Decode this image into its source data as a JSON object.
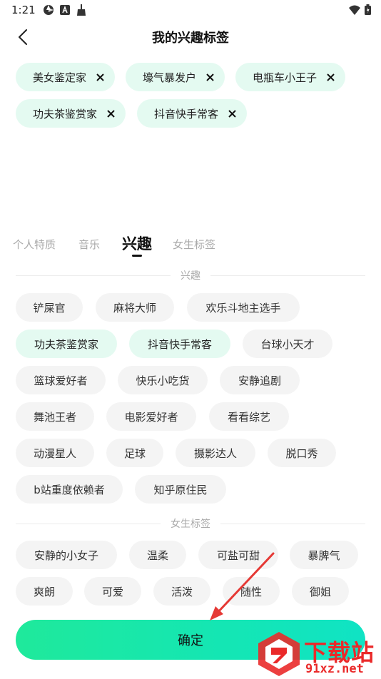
{
  "status_bar": {
    "time": "1:21"
  },
  "header": {
    "title": "我的兴趣标签"
  },
  "selected_tags": [
    {
      "label": "美女鉴定家"
    },
    {
      "label": "壕气暴发户"
    },
    {
      "label": "电瓶车小王子"
    },
    {
      "label": "功夫茶鉴赏家"
    },
    {
      "label": "抖音快手常客"
    }
  ],
  "tabs": [
    {
      "label": "个人特质",
      "active": false
    },
    {
      "label": "音乐",
      "active": false
    },
    {
      "label": "兴趣",
      "active": true
    },
    {
      "label": "女生标签",
      "active": false
    }
  ],
  "sections": {
    "interest": {
      "title": "兴趣",
      "tags": [
        {
          "label": "铲屎官",
          "selected": false
        },
        {
          "label": "麻将大师",
          "selected": false
        },
        {
          "label": "欢乐斗地主选手",
          "selected": false
        },
        {
          "label": "功夫茶鉴赏家",
          "selected": true
        },
        {
          "label": "抖音快手常客",
          "selected": true
        },
        {
          "label": "台球小天才",
          "selected": false
        },
        {
          "label": "篮球爱好者",
          "selected": false
        },
        {
          "label": "快乐小吃货",
          "selected": false
        },
        {
          "label": "安静追剧",
          "selected": false
        },
        {
          "label": "舞池王者",
          "selected": false
        },
        {
          "label": "电影爱好者",
          "selected": false
        },
        {
          "label": "看看综艺",
          "selected": false
        },
        {
          "label": "动漫星人",
          "selected": false
        },
        {
          "label": "足球",
          "selected": false
        },
        {
          "label": "摄影达人",
          "selected": false
        },
        {
          "label": "脱口秀",
          "selected": false
        },
        {
          "label": "b站重度依赖者",
          "selected": false
        },
        {
          "label": "知乎原住民",
          "selected": false
        }
      ]
    },
    "girl": {
      "title": "女生标签",
      "tags": [
        {
          "label": "安静的小女子",
          "selected": false
        },
        {
          "label": "温柔",
          "selected": false
        },
        {
          "label": "可盐可甜",
          "selected": false
        },
        {
          "label": "暴脾气",
          "selected": false
        },
        {
          "label": "爽朗",
          "selected": false
        },
        {
          "label": "可爱",
          "selected": false
        },
        {
          "label": "活泼",
          "selected": false
        },
        {
          "label": "随性",
          "selected": false
        },
        {
          "label": "御姐",
          "selected": false
        }
      ]
    }
  },
  "confirm_button": {
    "label": "确定"
  },
  "watermark": {
    "main": "下载站",
    "sub": "91xz.net"
  },
  "colors": {
    "accent": "#1fe99b",
    "chip_selected_bg": "#e4faf1",
    "chip_bg": "#f4f4f4",
    "annotation_arrow": "#e53935"
  }
}
